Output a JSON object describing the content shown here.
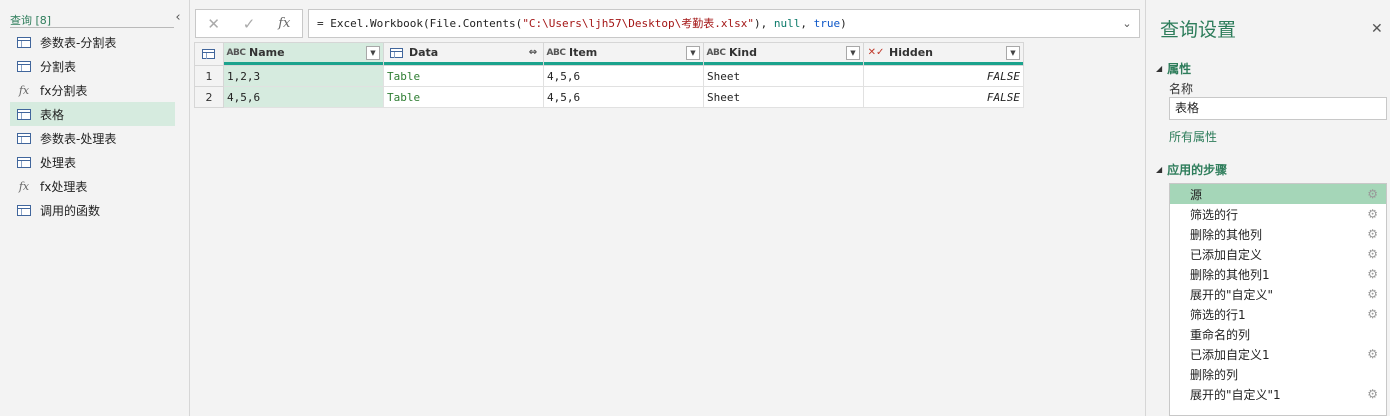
{
  "queries_pane": {
    "header": "查询 [8]",
    "collapse_icon": "chevron-left-icon",
    "items": [
      {
        "label": "参数表-分割表",
        "icon": "table-icon",
        "selected": false
      },
      {
        "label": "分割表",
        "icon": "table-icon",
        "selected": false
      },
      {
        "label": "fx分割表",
        "icon": "function-icon",
        "selected": false
      },
      {
        "label": "表格",
        "icon": "table-icon",
        "selected": true
      },
      {
        "label": "参数表-处理表",
        "icon": "table-icon",
        "selected": false
      },
      {
        "label": "处理表",
        "icon": "table-icon",
        "selected": false
      },
      {
        "label": "fx处理表",
        "icon": "function-icon",
        "selected": false
      },
      {
        "label": "调用的函数",
        "icon": "table-icon",
        "selected": false
      }
    ]
  },
  "formula_bar": {
    "cancel_glyph": "✕",
    "confirm_glyph": "✓",
    "fx_glyph": "fx",
    "parts": [
      {
        "text": "= Excel.Workbook(File.Contents(",
        "cls": ""
      },
      {
        "text": "\"C:\\Users\\ljh57\\Desktop\\考勤表.xlsx\"",
        "cls": "s"
      },
      {
        "text": "), ",
        "cls": ""
      },
      {
        "text": "null",
        "cls": "nm"
      },
      {
        "text": ", ",
        "cls": ""
      },
      {
        "text": "true",
        "cls": "kw"
      },
      {
        "text": ")",
        "cls": ""
      }
    ],
    "expand_glyph": "⌄"
  },
  "grid": {
    "columns": [
      {
        "label": "Name",
        "type_icon": "text-type-icon",
        "type_text": "ABC",
        "dropdown": true,
        "selected": true
      },
      {
        "label": "Data",
        "type_icon": "table-type-icon",
        "type_text": "",
        "dropdown": false,
        "expand": true,
        "selected": false
      },
      {
        "label": "Item",
        "type_icon": "text-type-icon",
        "type_text": "ABC",
        "dropdown": true,
        "selected": false
      },
      {
        "label": "Kind",
        "type_icon": "text-type-icon",
        "type_text": "ABC",
        "dropdown": true,
        "selected": false
      },
      {
        "label": "Hidden",
        "type_icon": "logical-type-icon",
        "type_text": "✕✓",
        "dropdown": true,
        "selected": false
      }
    ],
    "rows": [
      {
        "num": "1",
        "cells": [
          "1,2,3",
          "Table",
          "4,5,6",
          "Sheet",
          "FALSE"
        ]
      },
      {
        "num": "2",
        "cells": [
          "4,5,6",
          "Table",
          "4,5,6",
          "Sheet",
          "FALSE"
        ]
      }
    ]
  },
  "settings_pane": {
    "title": "查询设置",
    "close_glyph": "✕",
    "properties_header": "属性",
    "name_label": "名称",
    "name_value": "表格",
    "all_properties_link": "所有属性",
    "steps_header": "应用的步骤",
    "steps": [
      {
        "label": "源",
        "gear": true,
        "selected": true
      },
      {
        "label": "筛选的行",
        "gear": true,
        "selected": false
      },
      {
        "label": "删除的其他列",
        "gear": true,
        "selected": false
      },
      {
        "label": "已添加自定义",
        "gear": true,
        "selected": false
      },
      {
        "label": "删除的其他列1",
        "gear": true,
        "selected": false
      },
      {
        "label": "展开的\"自定义\"",
        "gear": true,
        "selected": false
      },
      {
        "label": "筛选的行1",
        "gear": true,
        "selected": false
      },
      {
        "label": "重命名的列",
        "gear": false,
        "selected": false
      },
      {
        "label": "已添加自定义1",
        "gear": true,
        "selected": false
      },
      {
        "label": "删除的列",
        "gear": false,
        "selected": false
      },
      {
        "label": "展开的\"自定义\"1",
        "gear": true,
        "selected": false
      }
    ]
  },
  "colors": {
    "accent": "#2e7d5b",
    "selection": "#d6ebdf",
    "column_underline": "#1ba38d"
  }
}
